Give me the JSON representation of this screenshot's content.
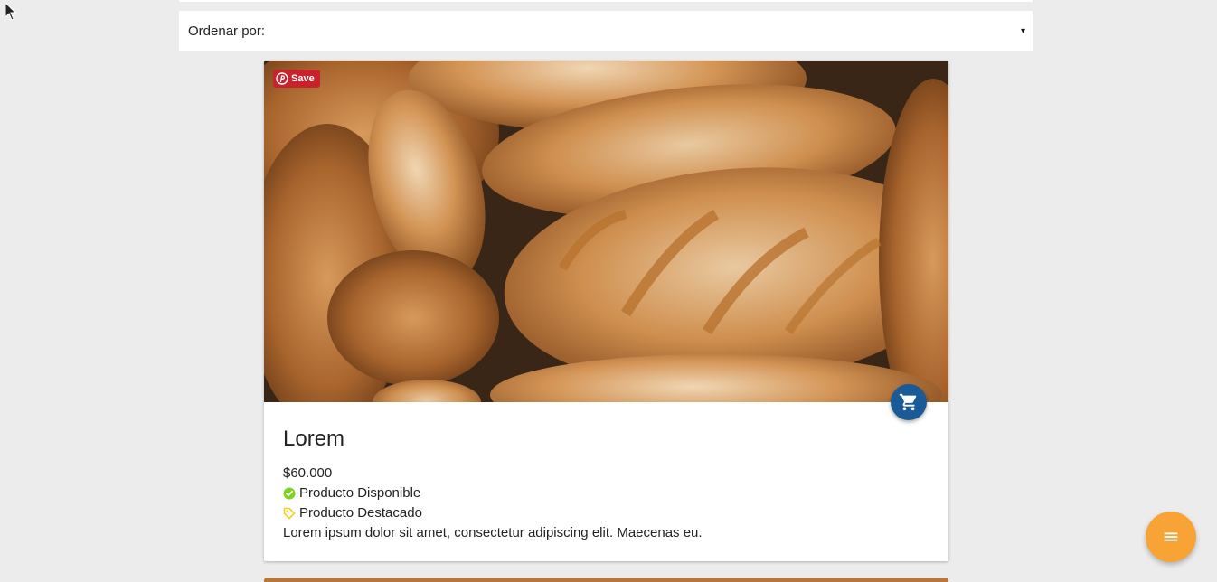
{
  "sort": {
    "label": "Ordenar por:",
    "arrow": "▾"
  },
  "product": {
    "pin_save_label": "Save",
    "title": "Lorem",
    "price": "$60.000",
    "availability": "Producto Disponible",
    "featured": "Producto Destacado",
    "description": "Lorem ipsum dolor sit amet, consectetur adipiscing elit. Maecenas eu.",
    "image_subject": "bread-loaves-photo"
  },
  "icons": {
    "cart": "shopping-cart-icon",
    "menu": "menu-icon",
    "check": "check-circle-icon",
    "tag": "tag-icon",
    "pinterest": "pinterest-icon"
  },
  "colors": {
    "background": "#ececec",
    "card": "#ffffff",
    "cart_fab": "#1a5a96",
    "menu_fab": "#f7a336",
    "pinterest": "#c8232c",
    "check": "#7ed321",
    "tag": "#f5d020"
  }
}
